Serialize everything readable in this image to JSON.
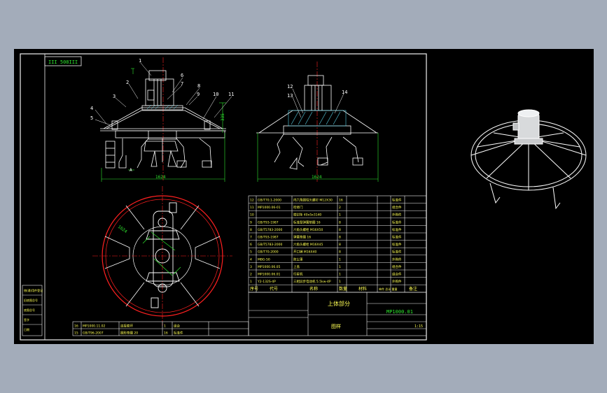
{
  "colors": {
    "background": "#a3acba",
    "canvas": "#000000",
    "line_white": "#ffffff",
    "center_red": "#ff2020",
    "dim_green": "#2ee82e",
    "hatch_cyan": "#59d3e8",
    "text_yellow": "#ffff55",
    "frame_white": "#f0f0f0"
  },
  "header_label": "III 508III",
  "balloons": [
    "1",
    "2",
    "3",
    "4",
    "5",
    "6",
    "7",
    "8",
    "9",
    "10",
    "11",
    "12",
    "13",
    "14"
  ],
  "dims": {
    "front_width": "1624",
    "right_width": "1624",
    "height": "335",
    "view_a": "A"
  },
  "bom": {
    "rows": [
      {
        "no": "12",
        "code": "GB/T70.1-2000",
        "name": "内六角圆柱头螺钉 M12X30",
        "qty": "16",
        "mat": "",
        "note": "标准件"
      },
      {
        "no": "11",
        "code": "MP1000.06-01",
        "name": "检修门",
        "qty": "2",
        "mat": "",
        "note": "组合件"
      },
      {
        "no": "10",
        "code": "",
        "name": "密封条 40x5x3140",
        "qty": "1",
        "mat": "",
        "note": "外购件"
      },
      {
        "no": "9",
        "code": "GB/T93-1987",
        "name": "标准型弹簧垫圈 16",
        "qty": "8",
        "mat": "",
        "note": "标准件"
      },
      {
        "no": "8",
        "code": "GB/T5783-2000",
        "name": "六角头螺栓 M16X50",
        "qty": "8",
        "mat": "",
        "note": "标准件"
      },
      {
        "no": "7",
        "code": "GB/T93-1987",
        "name": "弹簧垫圈 16",
        "qty": "8",
        "mat": "",
        "note": "标准件"
      },
      {
        "no": "6",
        "code": "GB/T5783-2000",
        "name": "六角头螺栓 M16X45",
        "qty": "8",
        "mat": "",
        "note": "标准件"
      },
      {
        "no": "5",
        "code": "GB/T70-2000",
        "name": "开口销 M16X40",
        "qty": "8",
        "mat": "",
        "note": "标准件"
      },
      {
        "no": "4",
        "code": "MBG-50",
        "name": "防尘罩",
        "qty": "1",
        "mat": "",
        "note": "外购件"
      },
      {
        "no": "3",
        "code": "MP1000.06.05",
        "name": "上盖",
        "qty": "1",
        "mat": "",
        "note": "组合件"
      },
      {
        "no": "2",
        "code": "MP1000.06.01",
        "name": "行星机",
        "qty": "1",
        "mat": "",
        "note": "组合件"
      },
      {
        "no": "1",
        "code": "Y2-132S-4P",
        "name": "三相异步电动机 5.5kw-4P",
        "qty": "1",
        "mat": "",
        "note": "外购件"
      }
    ],
    "header": {
      "no": "序号",
      "code": "代号",
      "name": "名称",
      "qty": "数量",
      "mat": "材料",
      "weight": "单件 总计 重量",
      "note": "备注"
    }
  },
  "title_block": {
    "part_name": "上体部分",
    "drawing_no": "MP1000.01",
    "subtitle": "图样",
    "scale": "1:15"
  },
  "lower_table": {
    "rows": [
      {
        "no": "16",
        "code": "MP1000.11.02",
        "name": "连接套环",
        "qty": "1",
        "note": "组合"
      },
      {
        "no": "15",
        "code": "GB/T96-2007",
        "name": "圆形垫圈 20",
        "qty": "16",
        "note": "标准件"
      }
    ]
  },
  "side_labels": [
    "借(通)用件登记",
    "旧底图总号",
    "底图总号",
    "签字",
    "日期"
  ]
}
